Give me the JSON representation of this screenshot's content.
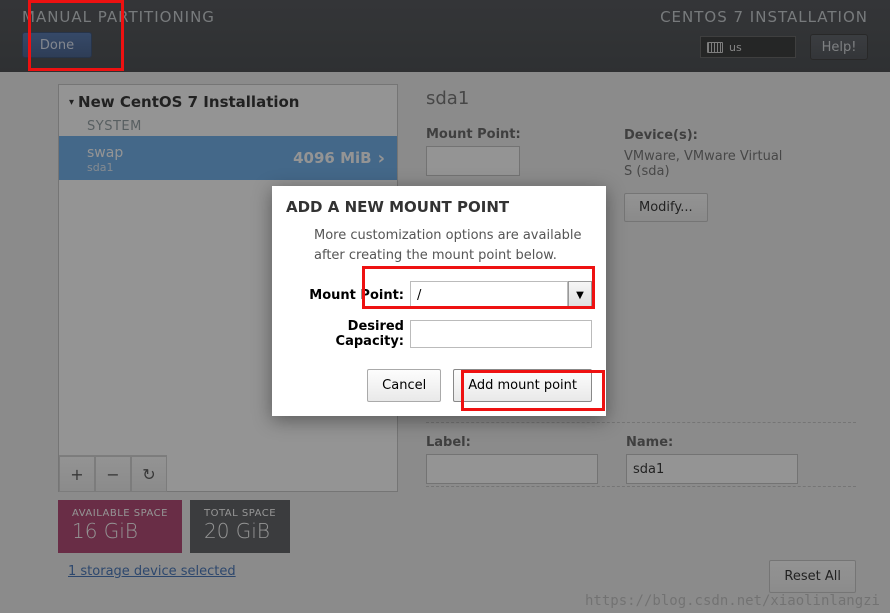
{
  "header": {
    "title_left": "MANUAL PARTITIONING",
    "done_label": "Done",
    "title_right": "CENTOS 7 INSTALLATION",
    "keyboard": "us",
    "help_label": "Help!"
  },
  "tree": {
    "root_label": "New CentOS 7 Installation",
    "section": "SYSTEM",
    "item": {
      "name": "swap",
      "device": "sda1",
      "size": "4096 MiB"
    },
    "toolbar": {
      "add": "+",
      "remove": "−",
      "reload": "↻"
    }
  },
  "details": {
    "device_title": "sda1",
    "mount_point_label": "Mount Point:",
    "mount_point_value": "",
    "devices_label": "Device(s):",
    "devices_text": "VMware, VMware Virtual S (sda)",
    "modify_label": "Modify...",
    "label_label": "Label:",
    "label_value": "",
    "name_label": "Name:",
    "name_value": "sda1"
  },
  "space": {
    "avail_label": "AVAILABLE SPACE",
    "avail_value": "16 GiB",
    "total_label": "TOTAL SPACE",
    "total_value": "20 GiB"
  },
  "footer": {
    "storage_link": "1 storage device selected",
    "reset_label": "Reset All"
  },
  "dialog": {
    "title": "ADD A NEW MOUNT POINT",
    "desc": "More customization options are available after creating the mount point below.",
    "mount_label": "Mount Point:",
    "mount_value": "/",
    "capacity_label": "Desired Capacity:",
    "capacity_value": "",
    "cancel_label": "Cancel",
    "add_label": "Add mount point"
  },
  "watermark": "https://blog.csdn.net/xiaolinlangzi"
}
